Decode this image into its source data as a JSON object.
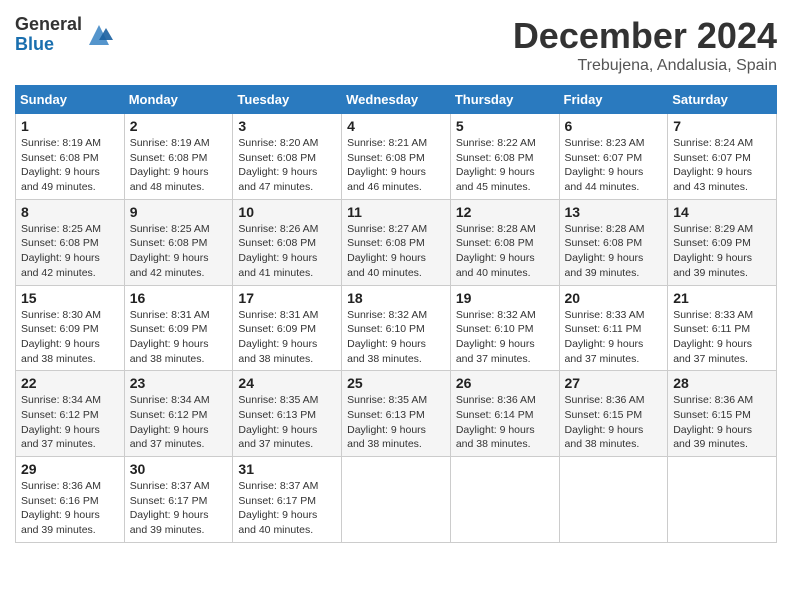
{
  "logo": {
    "general": "General",
    "blue": "Blue"
  },
  "title": "December 2024",
  "location": "Trebujena, Andalusia, Spain",
  "days_header": [
    "Sunday",
    "Monday",
    "Tuesday",
    "Wednesday",
    "Thursday",
    "Friday",
    "Saturday"
  ],
  "weeks": [
    [
      {
        "day": "1",
        "rise": "8:19 AM",
        "set": "6:08 PM",
        "daylight": "9 hours and 49 minutes."
      },
      {
        "day": "2",
        "rise": "8:19 AM",
        "set": "6:08 PM",
        "daylight": "9 hours and 48 minutes."
      },
      {
        "day": "3",
        "rise": "8:20 AM",
        "set": "6:08 PM",
        "daylight": "9 hours and 47 minutes."
      },
      {
        "day": "4",
        "rise": "8:21 AM",
        "set": "6:08 PM",
        "daylight": "9 hours and 46 minutes."
      },
      {
        "day": "5",
        "rise": "8:22 AM",
        "set": "6:08 PM",
        "daylight": "9 hours and 45 minutes."
      },
      {
        "day": "6",
        "rise": "8:23 AM",
        "set": "6:07 PM",
        "daylight": "9 hours and 44 minutes."
      },
      {
        "day": "7",
        "rise": "8:24 AM",
        "set": "6:07 PM",
        "daylight": "9 hours and 43 minutes."
      }
    ],
    [
      {
        "day": "8",
        "rise": "8:25 AM",
        "set": "6:08 PM",
        "daylight": "9 hours and 42 minutes."
      },
      {
        "day": "9",
        "rise": "8:25 AM",
        "set": "6:08 PM",
        "daylight": "9 hours and 42 minutes."
      },
      {
        "day": "10",
        "rise": "8:26 AM",
        "set": "6:08 PM",
        "daylight": "9 hours and 41 minutes."
      },
      {
        "day": "11",
        "rise": "8:27 AM",
        "set": "6:08 PM",
        "daylight": "9 hours and 40 minutes."
      },
      {
        "day": "12",
        "rise": "8:28 AM",
        "set": "6:08 PM",
        "daylight": "9 hours and 40 minutes."
      },
      {
        "day": "13",
        "rise": "8:28 AM",
        "set": "6:08 PM",
        "daylight": "9 hours and 39 minutes."
      },
      {
        "day": "14",
        "rise": "8:29 AM",
        "set": "6:09 PM",
        "daylight": "9 hours and 39 minutes."
      }
    ],
    [
      {
        "day": "15",
        "rise": "8:30 AM",
        "set": "6:09 PM",
        "daylight": "9 hours and 38 minutes."
      },
      {
        "day": "16",
        "rise": "8:31 AM",
        "set": "6:09 PM",
        "daylight": "9 hours and 38 minutes."
      },
      {
        "day": "17",
        "rise": "8:31 AM",
        "set": "6:09 PM",
        "daylight": "9 hours and 38 minutes."
      },
      {
        "day": "18",
        "rise": "8:32 AM",
        "set": "6:10 PM",
        "daylight": "9 hours and 38 minutes."
      },
      {
        "day": "19",
        "rise": "8:32 AM",
        "set": "6:10 PM",
        "daylight": "9 hours and 37 minutes."
      },
      {
        "day": "20",
        "rise": "8:33 AM",
        "set": "6:11 PM",
        "daylight": "9 hours and 37 minutes."
      },
      {
        "day": "21",
        "rise": "8:33 AM",
        "set": "6:11 PM",
        "daylight": "9 hours and 37 minutes."
      }
    ],
    [
      {
        "day": "22",
        "rise": "8:34 AM",
        "set": "6:12 PM",
        "daylight": "9 hours and 37 minutes."
      },
      {
        "day": "23",
        "rise": "8:34 AM",
        "set": "6:12 PM",
        "daylight": "9 hours and 37 minutes."
      },
      {
        "day": "24",
        "rise": "8:35 AM",
        "set": "6:13 PM",
        "daylight": "9 hours and 37 minutes."
      },
      {
        "day": "25",
        "rise": "8:35 AM",
        "set": "6:13 PM",
        "daylight": "9 hours and 38 minutes."
      },
      {
        "day": "26",
        "rise": "8:36 AM",
        "set": "6:14 PM",
        "daylight": "9 hours and 38 minutes."
      },
      {
        "day": "27",
        "rise": "8:36 AM",
        "set": "6:15 PM",
        "daylight": "9 hours and 38 minutes."
      },
      {
        "day": "28",
        "rise": "8:36 AM",
        "set": "6:15 PM",
        "daylight": "9 hours and 39 minutes."
      }
    ],
    [
      {
        "day": "29",
        "rise": "8:36 AM",
        "set": "6:16 PM",
        "daylight": "9 hours and 39 minutes."
      },
      {
        "day": "30",
        "rise": "8:37 AM",
        "set": "6:17 PM",
        "daylight": "9 hours and 39 minutes."
      },
      {
        "day": "31",
        "rise": "8:37 AM",
        "set": "6:17 PM",
        "daylight": "9 hours and 40 minutes."
      },
      null,
      null,
      null,
      null
    ]
  ],
  "labels": {
    "sunrise": "Sunrise:",
    "sunset": "Sunset:",
    "daylight": "Daylight:"
  }
}
